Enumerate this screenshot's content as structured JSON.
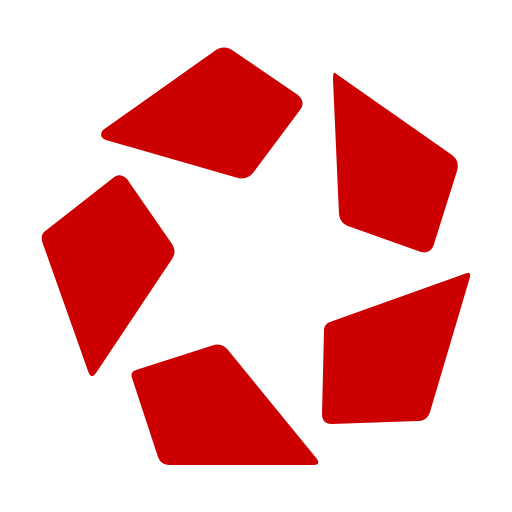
{
  "logo": {
    "icon": "five-segment-pentagon-star-logo-icon",
    "segment_count": 5,
    "segment_names": [
      "logo-segment-top-left",
      "logo-segment-top-right",
      "logo-segment-left",
      "logo-segment-bottom-right",
      "logo-segment-bottom-left"
    ]
  },
  "colors": {
    "background": "#ffffff",
    "segment_fill": "#cc0000"
  }
}
